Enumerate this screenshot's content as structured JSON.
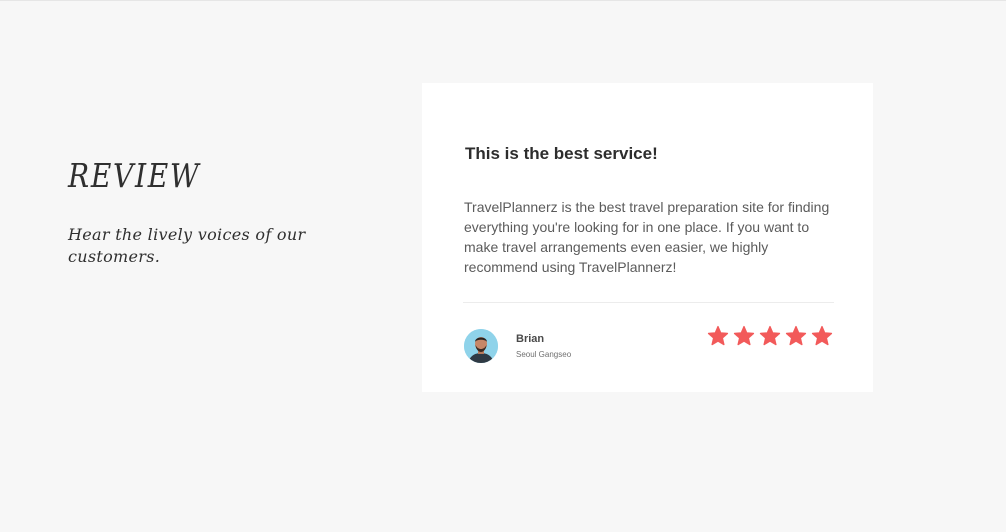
{
  "section": {
    "title": "REVIEW",
    "subtitle": "Hear the lively voices of our customers."
  },
  "review": {
    "headline": "This is the best service!",
    "body": "TravelPlannerz is the best travel preparation site for finding everything you're looking for in one place. If you want to make travel arrangements even easier, we highly recommend using TravelPlannerz!",
    "author": {
      "name": "Brian",
      "location": "Seoul Gangseo",
      "avatar_icon": "person-avatar-icon"
    },
    "rating": {
      "value": 5,
      "max": 5,
      "icon": "star-icon",
      "color": "#f25a5a"
    }
  },
  "colors": {
    "page_background": "#f7f7f7",
    "card_background": "#ffffff",
    "text_dark": "#2d2d2d",
    "text_body": "#5b5b5b",
    "star": "#f25a5a"
  }
}
